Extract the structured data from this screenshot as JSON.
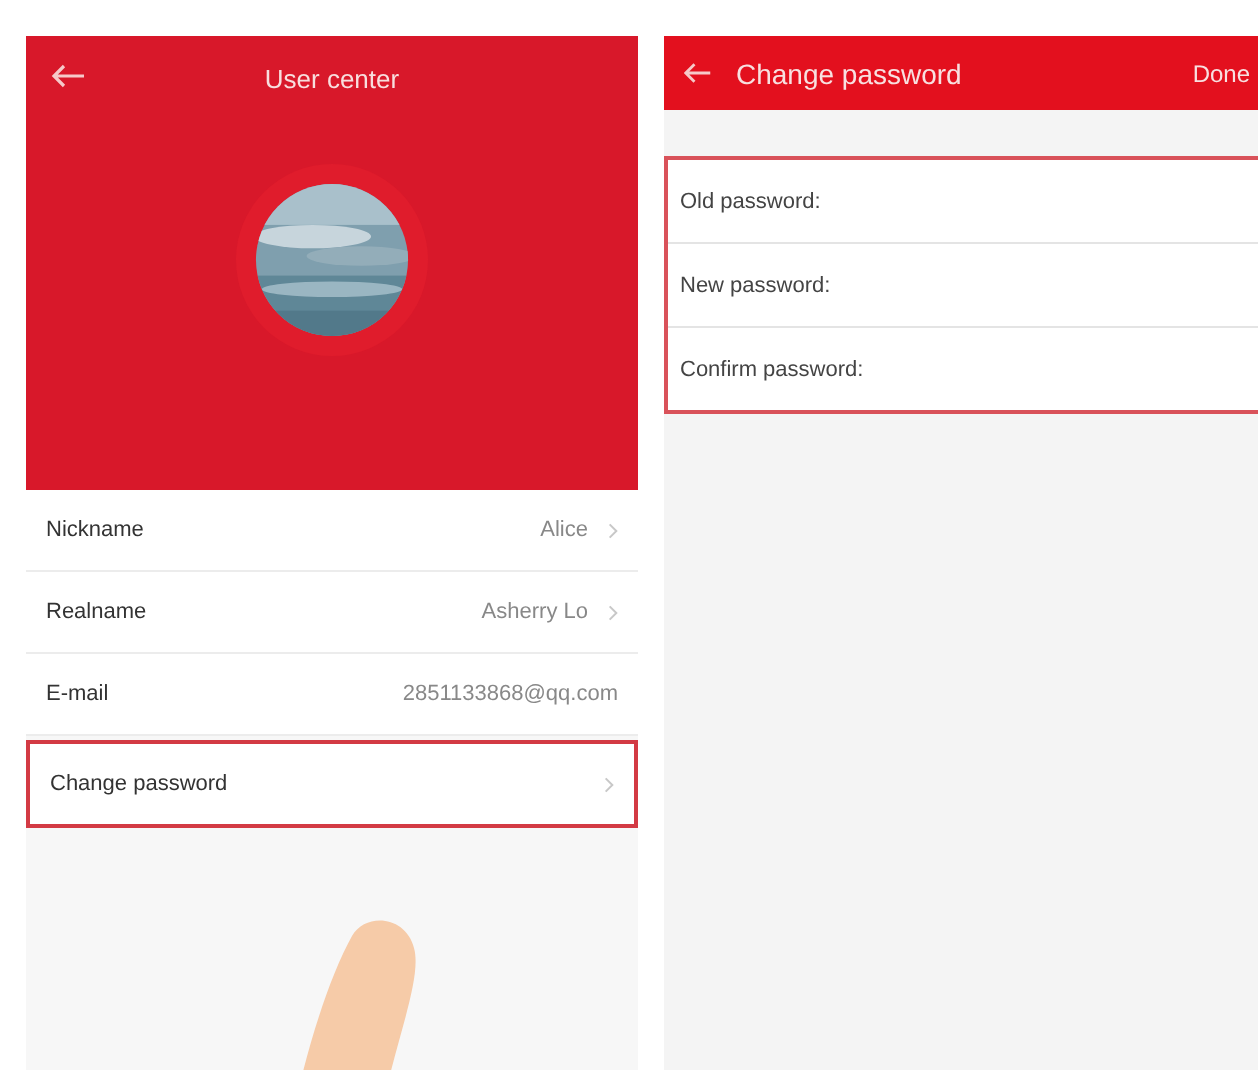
{
  "user_center": {
    "title": "User center",
    "rows": [
      {
        "label": "Nickname",
        "value": "Alice",
        "chevron": true,
        "highlighted": false
      },
      {
        "label": "Realname",
        "value": "Asherry Lo",
        "chevron": true,
        "highlighted": false
      },
      {
        "label": "E-mail",
        "value": "2851133868@qq.com",
        "chevron": false,
        "highlighted": false
      },
      {
        "label": "Change password",
        "chevron": true,
        "highlighted": true
      }
    ]
  },
  "change_password": {
    "title": "Change password",
    "action": "Done",
    "fields": [
      {
        "label": "Old password:"
      },
      {
        "label": "New password:"
      },
      {
        "label": "Confirm password:"
      }
    ]
  }
}
